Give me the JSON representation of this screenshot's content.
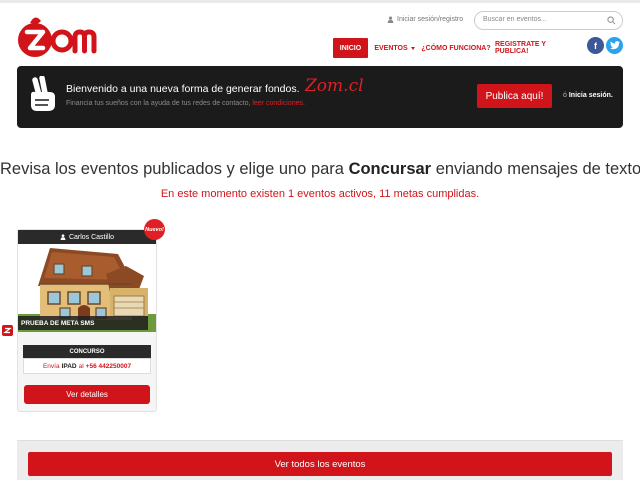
{
  "brand": {
    "name": "zom",
    "accent": "#d0141a"
  },
  "header": {
    "login_text": "Iniciar sesión/registro",
    "search_placeholder": "Buscar en eventos...",
    "nav": [
      {
        "label": "INICIO",
        "active": true
      },
      {
        "label": "EVENTOS"
      },
      {
        "label": "¿CÓMO FUNCIONA?"
      },
      {
        "label": "REGISTRATE Y PUBLICA!"
      }
    ],
    "social": {
      "facebook": "f",
      "twitter": "t"
    }
  },
  "banner": {
    "title": "Bienvenido a una nueva forma de generar fondos.",
    "brand_script": "Zom.cl",
    "subtitle": "Financia tus sueños con la ayuda de tus redes de contacto,",
    "subtitle_link": "leer condiciones.",
    "publish_button": "Publica aquí!",
    "login_prefix": "ó",
    "login_label": "Inicia sesión."
  },
  "main": {
    "headline_before": "Revisa los eventos publicados y elige uno para",
    "headline_bold": "Concursar",
    "headline_after": "enviando mensajes de texto.",
    "status": "En este momento existen 1 eventos activos, 11 metas cumplidas."
  },
  "events": [
    {
      "author": "Carlos Castillo",
      "badge": "Nuevo!",
      "title": "PRUEBA DE META SMS",
      "type": "CONCURSO",
      "sms_prefix": "Envía",
      "sms_keyword": "IPAD",
      "sms_mid": "al",
      "sms_number": "+56 442250007",
      "button": "Ver detalles"
    }
  ],
  "footer": {
    "all_events_button": "Ver todos los eventos"
  }
}
